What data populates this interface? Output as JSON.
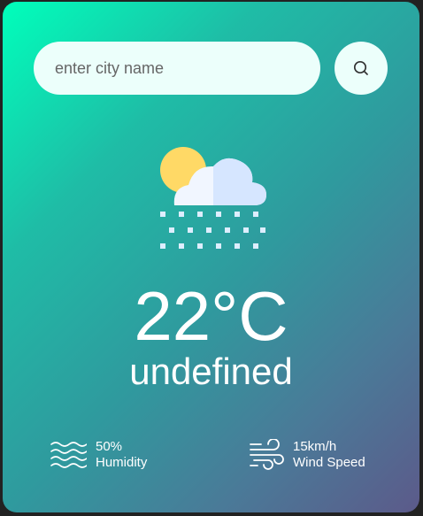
{
  "search": {
    "placeholder": "enter city name",
    "button_icon": "search-icon"
  },
  "weather": {
    "icon": "snow-cloud-sun-icon",
    "temperature": "22°C",
    "city": "undefined"
  },
  "details": {
    "humidity": {
      "icon": "humidity-waves-icon",
      "value": "50%",
      "label": "Humidity"
    },
    "wind": {
      "icon": "wind-icon",
      "value": "15km/h",
      "label": "Wind Speed"
    }
  },
  "colors": {
    "gradient_start": "#00ffbb",
    "gradient_end": "#5c5a8a",
    "input_bg": "#ecfffb",
    "text": "#ffffff"
  }
}
